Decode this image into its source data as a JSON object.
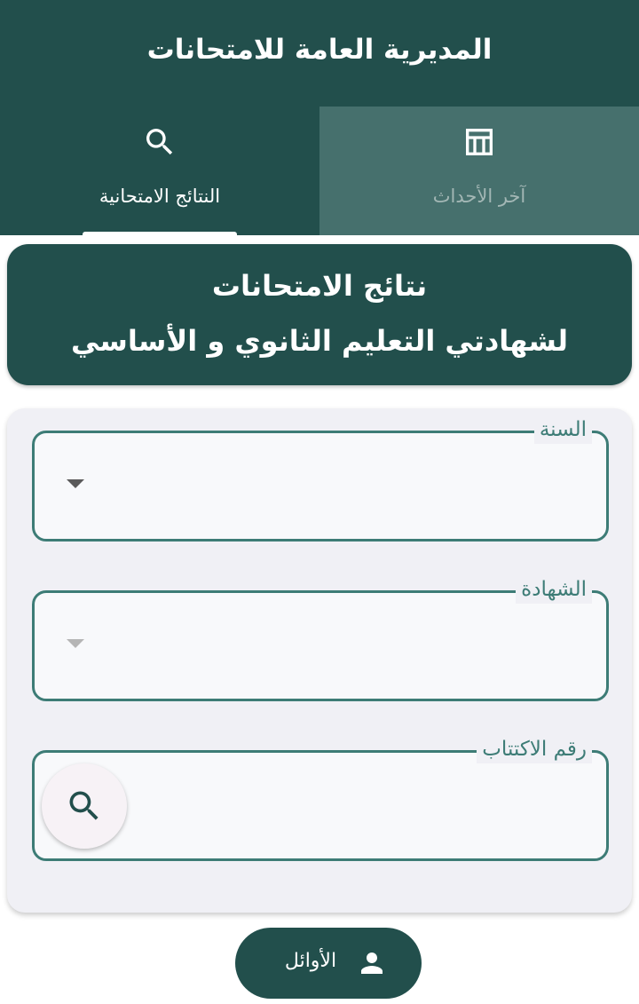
{
  "app_bar": {
    "title": "المديرية العامة للامتحانات"
  },
  "tabs": [
    {
      "label": "النتائج الامتحانية",
      "icon": "search-icon",
      "selected": true
    },
    {
      "label": "آخر الأحداث",
      "icon": "calendar-table-icon",
      "selected": false
    }
  ],
  "hero": {
    "line1": "نتائج الامتحانات",
    "line2": "لشهادتي التعليم الثانوي و الأساسي"
  },
  "form": {
    "year_label": "السنة",
    "certificate_label": "الشهادة",
    "seat_number_label": "رقم الاكتتاب",
    "year_value": "",
    "certificate_value": "",
    "seat_number_value": ""
  },
  "toppers_button": {
    "label": "الأوائل",
    "icon": "person-icon"
  },
  "colors": {
    "primary": "#224f4c",
    "tab_inactive": "#46706d",
    "accent_border": "#3d7c76",
    "card_bg": "#f0f0f5"
  }
}
